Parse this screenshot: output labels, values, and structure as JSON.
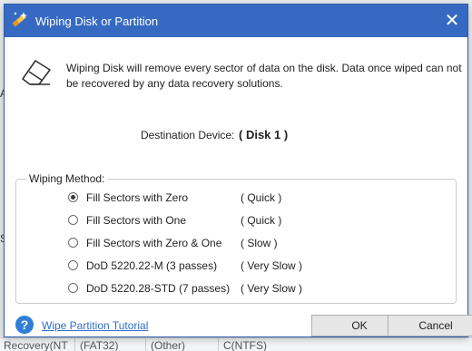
{
  "background": {
    "left_letters": [
      "A",
      "S"
    ],
    "row_cells": [
      "Recovery(NT",
      "(FAT32)",
      "(Other)",
      "C(NTFS)"
    ]
  },
  "dialog": {
    "title": "Wiping Disk or Partition",
    "title_icon": "minitool-wand-icon",
    "close_label": "✕",
    "warning_text": "Wiping Disk will remove every sector of data on the disk. Data once wiped can not be recovered by any data recovery solutions.",
    "destination_label": "Destination Device:",
    "destination_value": "( Disk 1 )",
    "wiping_method_label": "Wiping Method:",
    "options": [
      {
        "label": "Fill Sectors with Zero",
        "speed": "( Quick )",
        "selected": true
      },
      {
        "label": "Fill Sectors with One",
        "speed": "( Quick )",
        "selected": false
      },
      {
        "label": "Fill Sectors with Zero & One",
        "speed": "( Slow )",
        "selected": false
      },
      {
        "label": "DoD 5220.22-M (3 passes)",
        "speed": "( Very Slow )",
        "selected": false
      },
      {
        "label": "DoD 5220.28-STD (7 passes)",
        "speed": "( Very Slow )",
        "selected": false
      }
    ],
    "help_link": "Wipe Partition Tutorial",
    "ok_label": "OK",
    "cancel_label": "Cancel"
  },
  "colors": {
    "titlebar": "#3669c1",
    "link": "#2f6fc7",
    "help_icon": "#2f7fd6"
  }
}
